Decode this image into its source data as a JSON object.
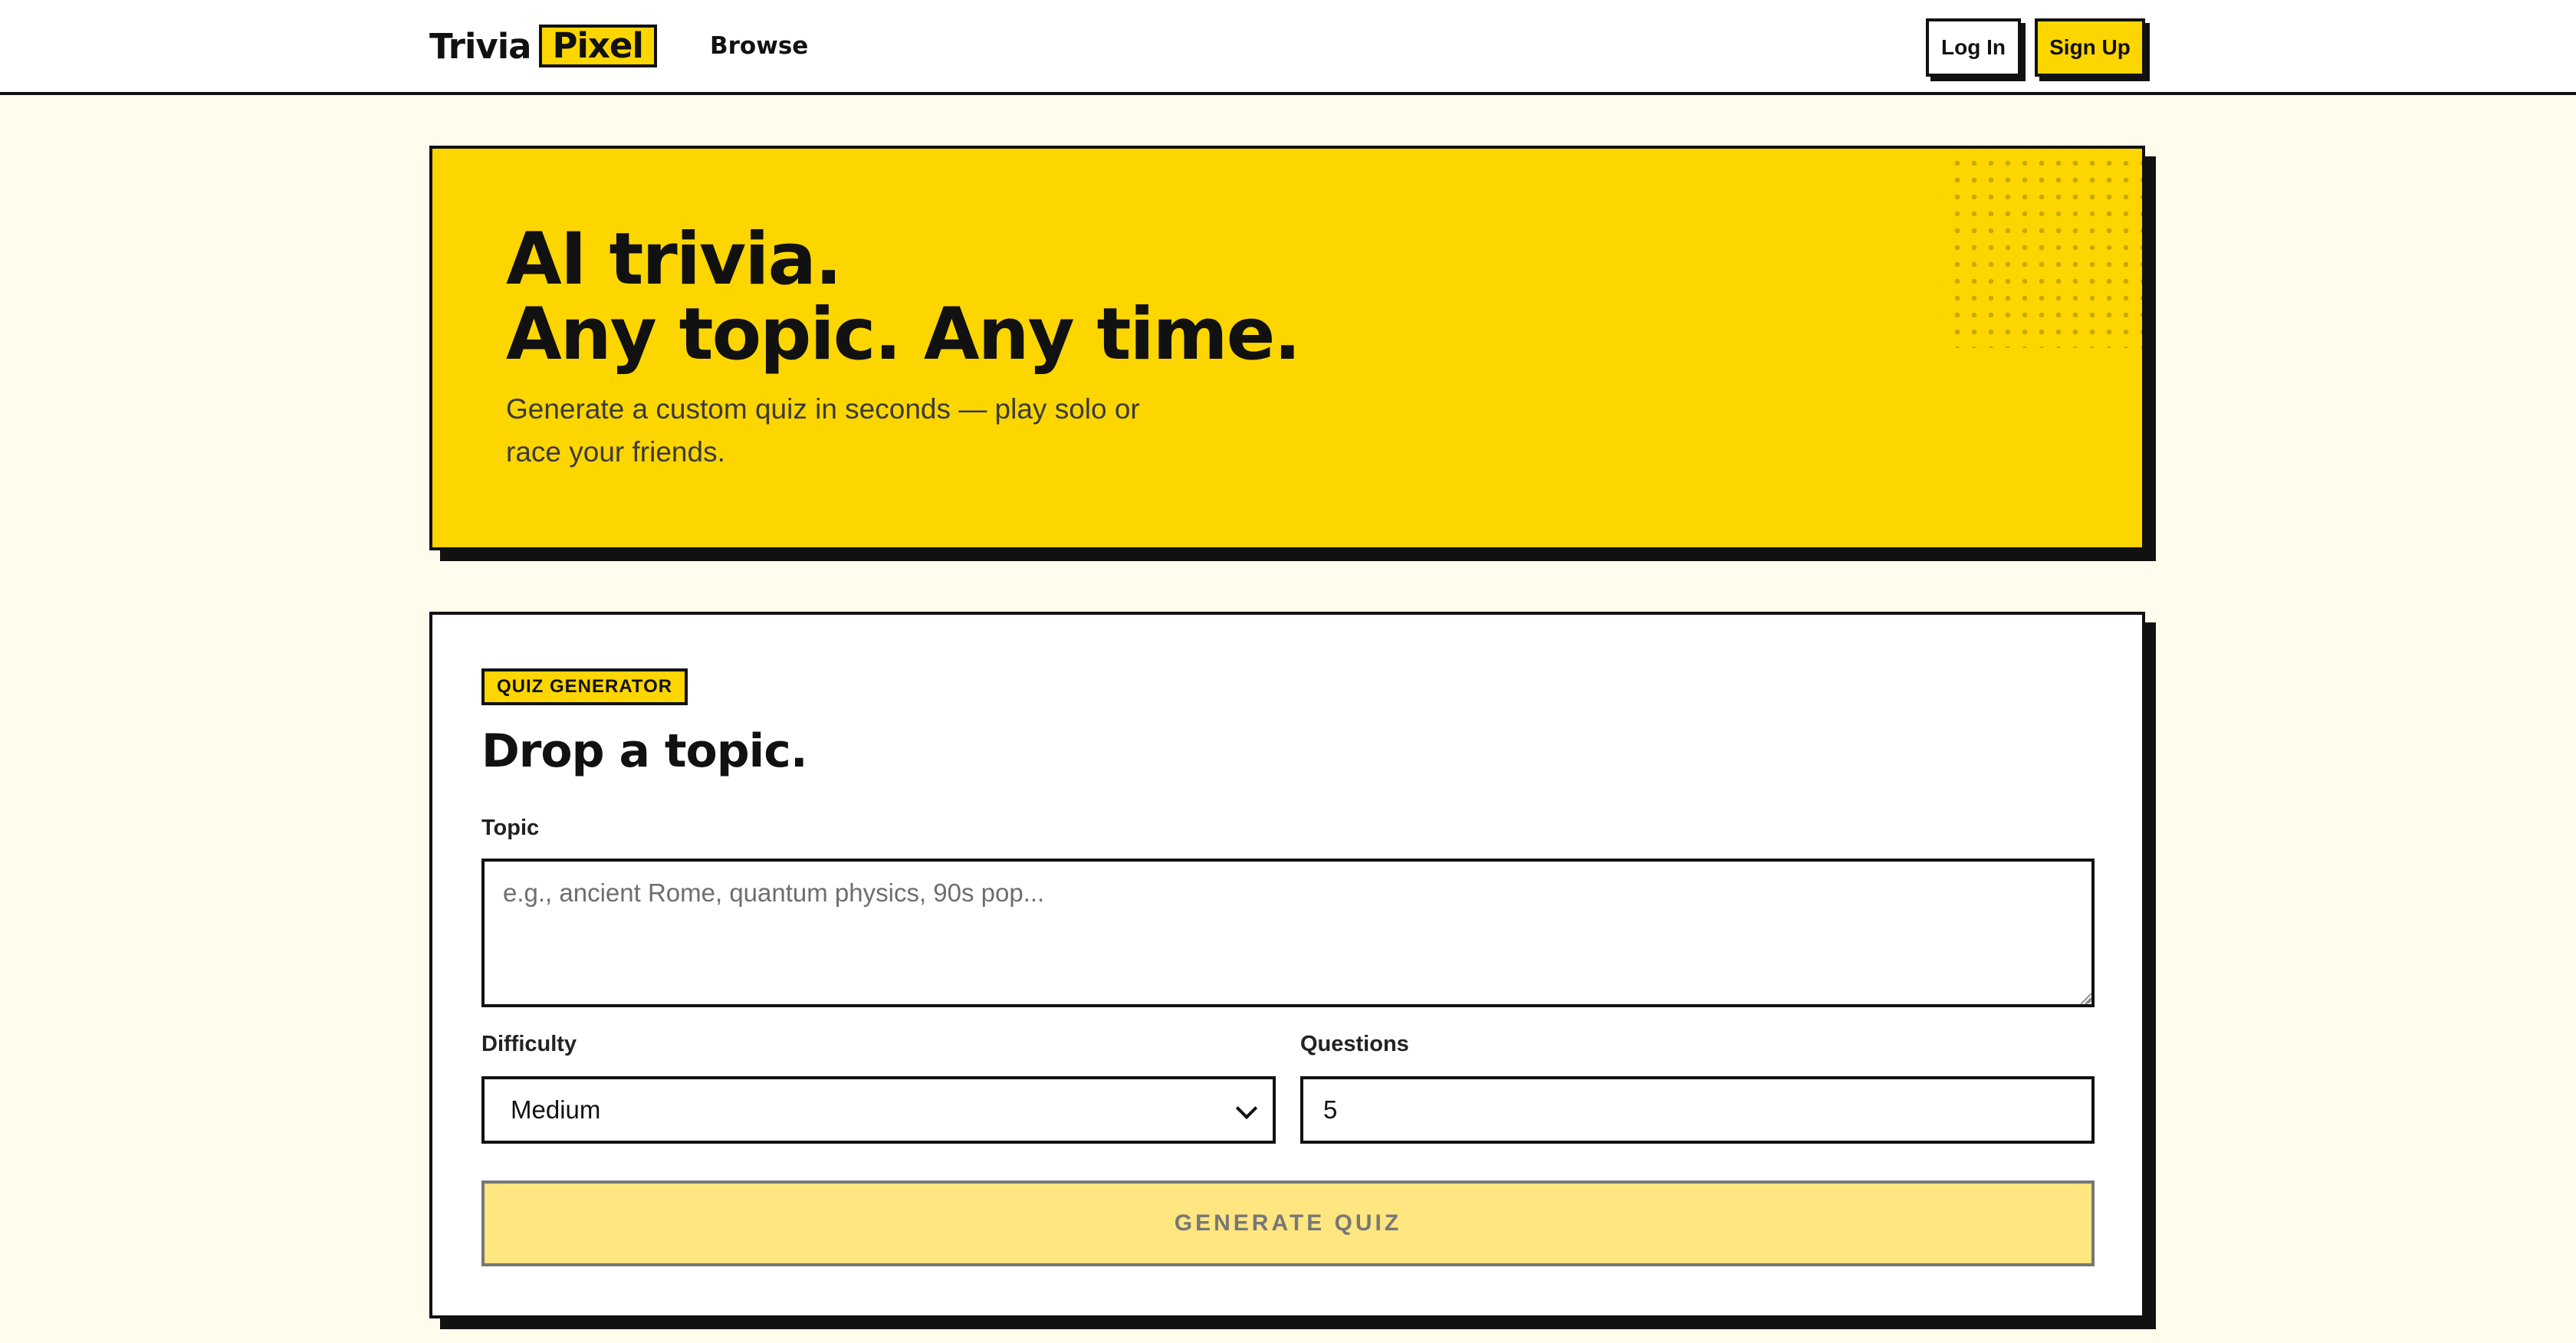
{
  "header": {
    "logo_word": "Trivia",
    "logo_box": "Pixel",
    "nav_browse": "Browse",
    "login_label": "Log In",
    "signup_label": "Sign Up"
  },
  "hero": {
    "title_line1": "AI trivia.",
    "title_line2": "Any topic. Any time.",
    "subtitle": "Generate a custom quiz in seconds — play solo or race your friends."
  },
  "generator": {
    "badge": "QUIZ GENERATOR",
    "title": "Drop a topic.",
    "topic_label": "Topic",
    "topic_placeholder": "e.g., ancient Rome, quantum physics, 90s pop...",
    "difficulty_label": "Difficulty",
    "difficulty_value": "Medium",
    "questions_label": "Questions",
    "questions_value": "5",
    "generate_label": "GENERATE QUIZ"
  },
  "colors": {
    "accent": "#FDD600",
    "page_bg": "#FFFCEE",
    "ink": "#111111",
    "disabled_button_bg": "#FFE680"
  },
  "icons": {
    "select_arrow": "chevron-down-icon",
    "textarea_grip": "resize-grip-icon"
  }
}
